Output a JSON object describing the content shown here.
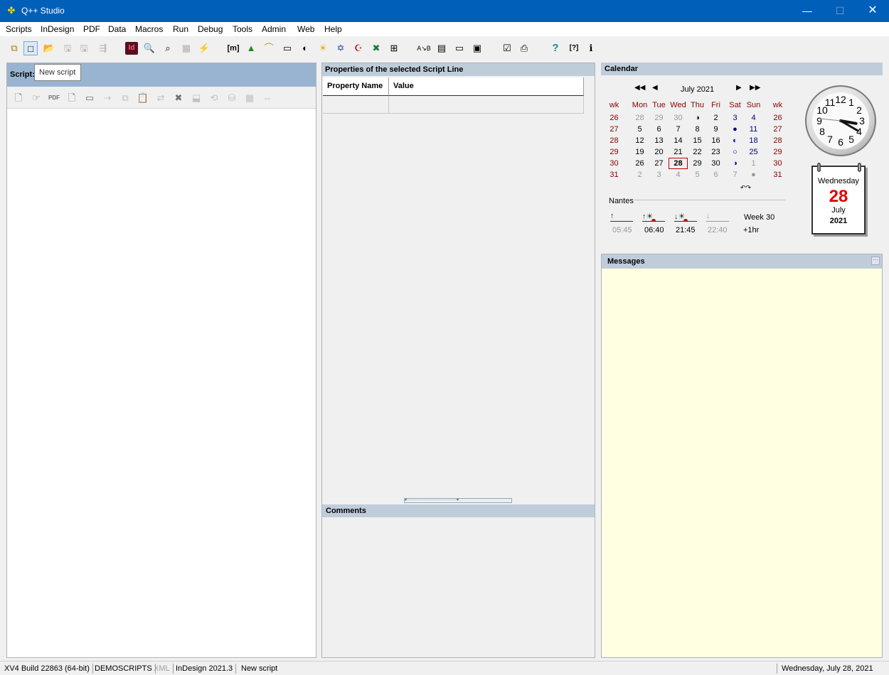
{
  "window": {
    "title": "Q++ Studio",
    "minimize_glyph": "—",
    "maximize_glyph": "☐",
    "close_glyph": "✕"
  },
  "menu": [
    "Scripts",
    "InDesign",
    "PDF",
    "Data",
    "Macros",
    "Run",
    "Debug",
    "Tools",
    "Admin",
    "Web",
    "Help"
  ],
  "toolbar": {
    "icons": [
      "tree-icon",
      "new-script-icon",
      "open-folder-icon",
      "save-icon",
      "save-all-icon",
      "export-icon",
      "indesign-icon",
      "search-icon",
      "find-replace-icon",
      "grid-icon",
      "lightning-icon",
      "macro-icon",
      "tree-green-icon",
      "lasso-icon",
      "comment-icon",
      "circle-icon",
      "sun-icon",
      "star-icon",
      "crescent-icon",
      "excel-icon",
      "network-icon",
      "sort-ab-icon",
      "form-icon",
      "chat-icon",
      "image-icon",
      "checklist-icon",
      "export-doc-icon",
      "help-icon",
      "context-help-icon",
      "info-icon"
    ],
    "glyphs": [
      "⧉",
      "□",
      "📂",
      "🖫",
      "🖫",
      "⇶",
      "Id",
      "🔍",
      "⌕",
      "▦",
      "⚡",
      "[m]",
      "▲",
      "⌒",
      "▭",
      "◐",
      "☀",
      "✡",
      "☪",
      "✖",
      "⊞",
      "A↘B",
      "▤",
      "▭",
      "▣",
      "☑",
      "⎙",
      "?",
      "[?]",
      "ℹ"
    ]
  },
  "script_panel": {
    "label": "Script:",
    "tooltip": "New script",
    "toolbar_glyphs": [
      "🗋",
      "☞",
      "PDF",
      "🗋",
      "▭",
      "⇢",
      "⧉",
      "📋",
      "⇄",
      "✖",
      "⬓",
      "⟲",
      "⛁",
      "▦",
      "⇔"
    ],
    "toolbar_names": [
      "new-line-icon",
      "pointer-icon",
      "pdf-icon",
      "page-icon",
      "window-icon",
      "step-icon",
      "copy-icon",
      "paste-icon",
      "swap-icon",
      "delete-icon",
      "insert-icon",
      "refresh-icon",
      "database-icon",
      "grid-icon",
      "merge-icon"
    ]
  },
  "properties": {
    "title": "Properties of the selected Script Line",
    "columns": [
      "Property Name",
      "Value"
    ],
    "comments_title": "Comments",
    "splitter_glyph": "▾···································▾"
  },
  "calendar": {
    "title": "Calendar",
    "nav_glyphs": [
      "◀◀",
      "◀",
      "▶",
      "▶▶"
    ],
    "month": "July 2021",
    "headers": [
      "wk",
      "Mon",
      "Tue",
      "Wed",
      "Thu",
      "Fri",
      "Sat",
      "Sun",
      "wk"
    ],
    "rows": [
      [
        "26",
        "28",
        "29",
        "30",
        "◑",
        "2",
        "3",
        "4",
        "26"
      ],
      [
        "27",
        "5",
        "6",
        "7",
        "8",
        "9",
        "●",
        "11",
        "27"
      ],
      [
        "28",
        "12",
        "13",
        "14",
        "15",
        "16",
        "◐",
        "18",
        "28"
      ],
      [
        "29",
        "19",
        "20",
        "21",
        "22",
        "23",
        "○",
        "25",
        "29"
      ],
      [
        "30",
        "26",
        "27",
        "28",
        "29",
        "30",
        "◑",
        "1",
        "30"
      ],
      [
        "31",
        "2",
        "3",
        "4",
        "5",
        "6",
        "7",
        "●",
        "31"
      ]
    ],
    "reset_glyph": "↶↷",
    "location": "Nantes",
    "sun_glyphs": [
      "↑",
      "↑☀",
      "↓☀",
      "↓"
    ],
    "sun_times": [
      "05:45",
      "06:40",
      "21:45",
      "22:40"
    ],
    "week": "Week 30",
    "tz": "+1hr",
    "clock_numbers": [
      "12",
      "1",
      "2",
      "3",
      "4",
      "5",
      "6",
      "7",
      "8",
      "9",
      "10",
      "11"
    ],
    "clock_time": {
      "hour": 15,
      "minute": 20,
      "second": 46
    },
    "card": {
      "day": "Wednesday",
      "date": "28",
      "month": "July",
      "year": "2021"
    }
  },
  "messages": {
    "title": "Messages",
    "more_glyph": "···"
  },
  "status": {
    "items": [
      "XV4 Build 22863 (64-bit)",
      "DEMOSCRIPTS",
      "XML",
      "InDesign 2021.3",
      "New script"
    ],
    "date": "Wednesday, July 28, 2021"
  },
  "colors": {
    "titlebar": "#005fb8",
    "header": "#bfcddb",
    "script_header": "#99b4d1",
    "messages_bg": "#ffffe1",
    "today": "#e00000",
    "weekend": "#000080",
    "week_num": "#8b0000"
  }
}
